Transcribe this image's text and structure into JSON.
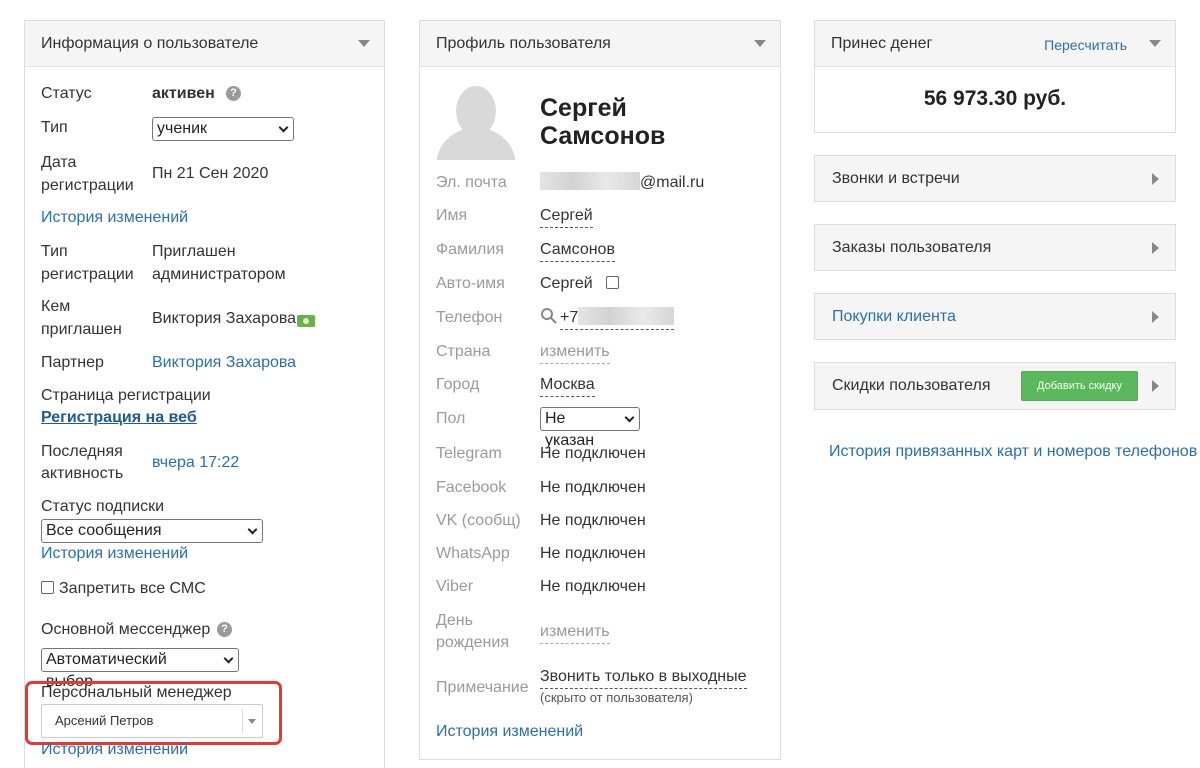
{
  "user_info": {
    "title": "Информация о пользователе",
    "status_label": "Статус",
    "status_value": "активен",
    "type_label": "Тип",
    "type_value": "ученик",
    "reg_date_label_1": "Дата",
    "reg_date_label_2": "регистрации",
    "reg_date_value": "Пн 21 Сен 2020",
    "history_link_1": "История изменений",
    "reg_type_label_1": "Тип",
    "reg_type_label_2": "регистрации",
    "reg_type_value_1": "Приглашен",
    "reg_type_value_2": "администратором",
    "invited_by_label_1": "Кем",
    "invited_by_label_2": "приглашен",
    "invited_by_value": "Виктория Захарова",
    "partner_label": "Партнер",
    "partner_value": "Виктория Захарова",
    "reg_page_label": "Страница регистрации",
    "reg_page_link": "Регистрация на веб",
    "last_activity_label_1": "Последняя",
    "last_activity_label_2": "активность",
    "last_activity_value": "вчера 17:22",
    "subscription_label": "Статус подписки",
    "subscription_value": "Все сообщения",
    "history_link_2": "История изменений",
    "block_sms_label": "Запретить все СМС",
    "messenger_label": "Основной мессенджер",
    "messenger_value": "Автоматический выбор",
    "manager_label": "Персональный менеджер",
    "manager_value": "Арсений Петров",
    "history_link_3": "История изменений"
  },
  "profile": {
    "title": "Профиль пользователя",
    "first_name_display": "Сергей",
    "last_name_display": "Самсонов",
    "email_label": "Эл. почта",
    "email_suffix": "@mail.ru",
    "name_label": "Имя",
    "name_value": "Сергей",
    "surname_label": "Фамилия",
    "surname_value": "Самсонов",
    "autoname_label": "Авто-имя",
    "autoname_value": "Сергей",
    "phone_label": "Телефон",
    "phone_prefix": "+7",
    "country_label": "Страна",
    "country_value": "изменить",
    "city_label": "Город",
    "city_value": "Москва",
    "gender_label": "Пол",
    "gender_value": "Не указан",
    "telegram_label": "Telegram",
    "telegram_value": "Не подключен",
    "facebook_label": "Facebook",
    "facebook_value": "Не подключен",
    "vk_label": "VK (сообщ)",
    "vk_value": "Не подключен",
    "whatsapp_label": "WhatsApp",
    "whatsapp_value": "Не подключен",
    "viber_label": "Viber",
    "viber_value": "Не подключен",
    "birthday_label_1": "День",
    "birthday_label_2": "рождения",
    "birthday_value": "изменить",
    "note_label": "Примечание",
    "note_value": "Звонить только в выходные",
    "note_hint": "(скрыто от пользователя)",
    "history_link": "История изменений"
  },
  "money": {
    "title": "Принес денег",
    "recalc_link": "Пересчитать",
    "amount": "56 973.30 руб."
  },
  "right_panels": {
    "calls": "Звонки и встречи",
    "orders": "Заказы пользователя",
    "purchases": "Покупки клиента",
    "discounts": "Скидки пользователя",
    "add_discount": "Добавить скидку"
  },
  "cards_history_link": "История привязанных карт и номеров телефонов",
  "colors": {
    "link": "#2a6fb0",
    "highlight": "#e53935",
    "button_green": "#5cb85c"
  }
}
